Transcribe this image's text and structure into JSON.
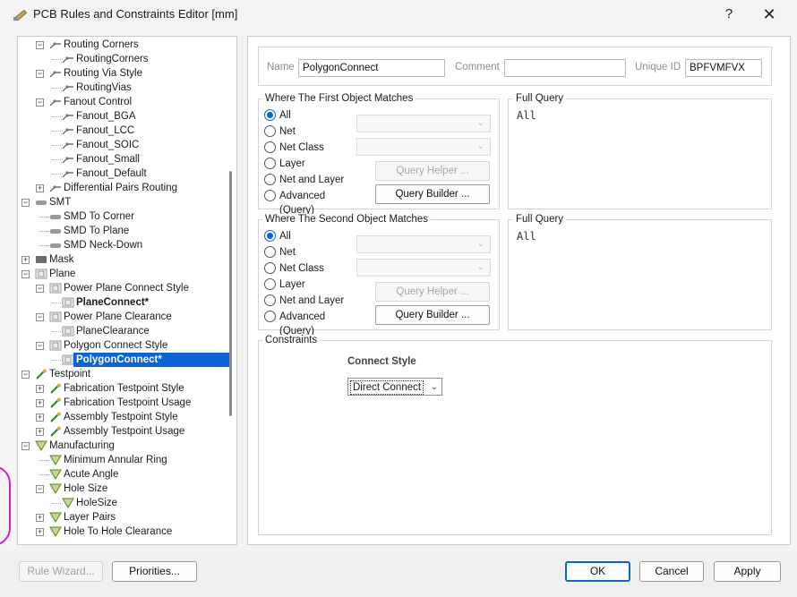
{
  "window": {
    "title": "PCB Rules and Constraints Editor [mm]",
    "help_glyph": "?",
    "close_glyph": "✕"
  },
  "tree": {
    "items": [
      {
        "label": "Routing Corners",
        "level": 2,
        "expander": "minus",
        "icon": "routing-icon"
      },
      {
        "label": "RoutingCorners",
        "level": 3,
        "expander": "",
        "icon": "routing-icon"
      },
      {
        "label": "Routing Via Style",
        "level": 2,
        "expander": "minus",
        "icon": "routing-icon"
      },
      {
        "label": "RoutingVias",
        "level": 3,
        "expander": "",
        "icon": "routing-icon"
      },
      {
        "label": "Fanout Control",
        "level": 2,
        "expander": "minus",
        "icon": "routing-icon"
      },
      {
        "label": "Fanout_BGA",
        "level": 3,
        "expander": "",
        "icon": "routing-icon"
      },
      {
        "label": "Fanout_LCC",
        "level": 3,
        "expander": "",
        "icon": "routing-icon"
      },
      {
        "label": "Fanout_SOIC",
        "level": 3,
        "expander": "",
        "icon": "routing-icon"
      },
      {
        "label": "Fanout_Small",
        "level": 3,
        "expander": "",
        "icon": "routing-icon"
      },
      {
        "label": "Fanout_Default",
        "level": 3,
        "expander": "",
        "icon": "routing-icon"
      },
      {
        "label": "Differential Pairs Routing",
        "level": 2,
        "expander": "plus",
        "icon": "routing-icon"
      },
      {
        "label": "SMT",
        "level": 1,
        "expander": "minus",
        "icon": "smt-icon"
      },
      {
        "label": "SMD To Corner",
        "level": 2,
        "expander": "",
        "icon": "smt-icon"
      },
      {
        "label": "SMD To Plane",
        "level": 2,
        "expander": "",
        "icon": "smt-icon"
      },
      {
        "label": "SMD Neck-Down",
        "level": 2,
        "expander": "",
        "icon": "smt-icon"
      },
      {
        "label": "Mask",
        "level": 1,
        "expander": "plus",
        "icon": "mask-icon"
      },
      {
        "label": "Plane",
        "level": 1,
        "expander": "minus",
        "icon": "plane-icon"
      },
      {
        "label": "Power Plane Connect Style",
        "level": 2,
        "expander": "minus",
        "icon": "plane-icon"
      },
      {
        "label": "PlaneConnect*",
        "level": 3,
        "expander": "",
        "icon": "plane-icon",
        "bold": true
      },
      {
        "label": "Power Plane Clearance",
        "level": 2,
        "expander": "minus",
        "icon": "plane-icon"
      },
      {
        "label": "PlaneClearance",
        "level": 3,
        "expander": "",
        "icon": "plane-icon"
      },
      {
        "label": "Polygon Connect Style",
        "level": 2,
        "expander": "minus",
        "icon": "plane-icon"
      },
      {
        "label": "PolygonConnect*",
        "level": 3,
        "expander": "",
        "icon": "plane-icon",
        "bold": true,
        "selected": true
      },
      {
        "label": "Testpoint",
        "level": 1,
        "expander": "minus",
        "icon": "testpoint-icon"
      },
      {
        "label": "Fabrication Testpoint Style",
        "level": 2,
        "expander": "plus",
        "icon": "testpoint-icon"
      },
      {
        "label": "Fabrication Testpoint Usage",
        "level": 2,
        "expander": "plus",
        "icon": "testpoint-icon"
      },
      {
        "label": "Assembly Testpoint Style",
        "level": 2,
        "expander": "plus",
        "icon": "testpoint-icon"
      },
      {
        "label": "Assembly Testpoint Usage",
        "level": 2,
        "expander": "plus",
        "icon": "testpoint-icon"
      },
      {
        "label": "Manufacturing",
        "level": 1,
        "expander": "minus",
        "icon": "manufacturing-icon"
      },
      {
        "label": "Minimum Annular Ring",
        "level": 2,
        "expander": "",
        "icon": "manufacturing-icon"
      },
      {
        "label": "Acute Angle",
        "level": 2,
        "expander": "",
        "icon": "manufacturing-icon"
      },
      {
        "label": "Hole Size",
        "level": 2,
        "expander": "minus",
        "icon": "manufacturing-icon"
      },
      {
        "label": "HoleSize",
        "level": 3,
        "expander": "",
        "icon": "manufacturing-icon"
      },
      {
        "label": "Layer Pairs",
        "level": 2,
        "expander": "plus",
        "icon": "manufacturing-icon"
      },
      {
        "label": "Hole To Hole Clearance",
        "level": 2,
        "expander": "plus",
        "icon": "manufacturing-icon"
      }
    ]
  },
  "rule": {
    "name_label": "Name",
    "name_value": "PolygonConnect",
    "comment_label": "Comment",
    "comment_value": "",
    "uid_label": "Unique ID",
    "uid_value": "BPFVMFVX"
  },
  "first_object": {
    "title": "Where The First Object Matches",
    "options": [
      "All",
      "Net",
      "Net Class",
      "Layer",
      "Net and Layer",
      "Advanced (Query)"
    ],
    "selected": "All",
    "query_helper": "Query Helper ...",
    "query_builder": "Query Builder ...",
    "full_query_title": "Full Query",
    "full_query": "All"
  },
  "second_object": {
    "title": "Where The Second Object Matches",
    "options": [
      "All",
      "Net",
      "Net Class",
      "Layer",
      "Net and Layer",
      "Advanced (Query)"
    ],
    "selected": "All",
    "query_helper": "Query Helper ...",
    "query_builder": "Query Builder ...",
    "full_query_title": "Full Query",
    "full_query": "All"
  },
  "constraints": {
    "title": "Constraints",
    "connect_style_label": "Connect Style",
    "connect_style_value": "Direct Connect"
  },
  "buttons": {
    "rule_wizard": "Rule Wizard...",
    "priorities": "Priorities...",
    "ok": "OK",
    "cancel": "Cancel",
    "apply": "Apply"
  },
  "colors": {
    "accent": "#0a64d6",
    "background_magenta": "#d21fc0"
  }
}
